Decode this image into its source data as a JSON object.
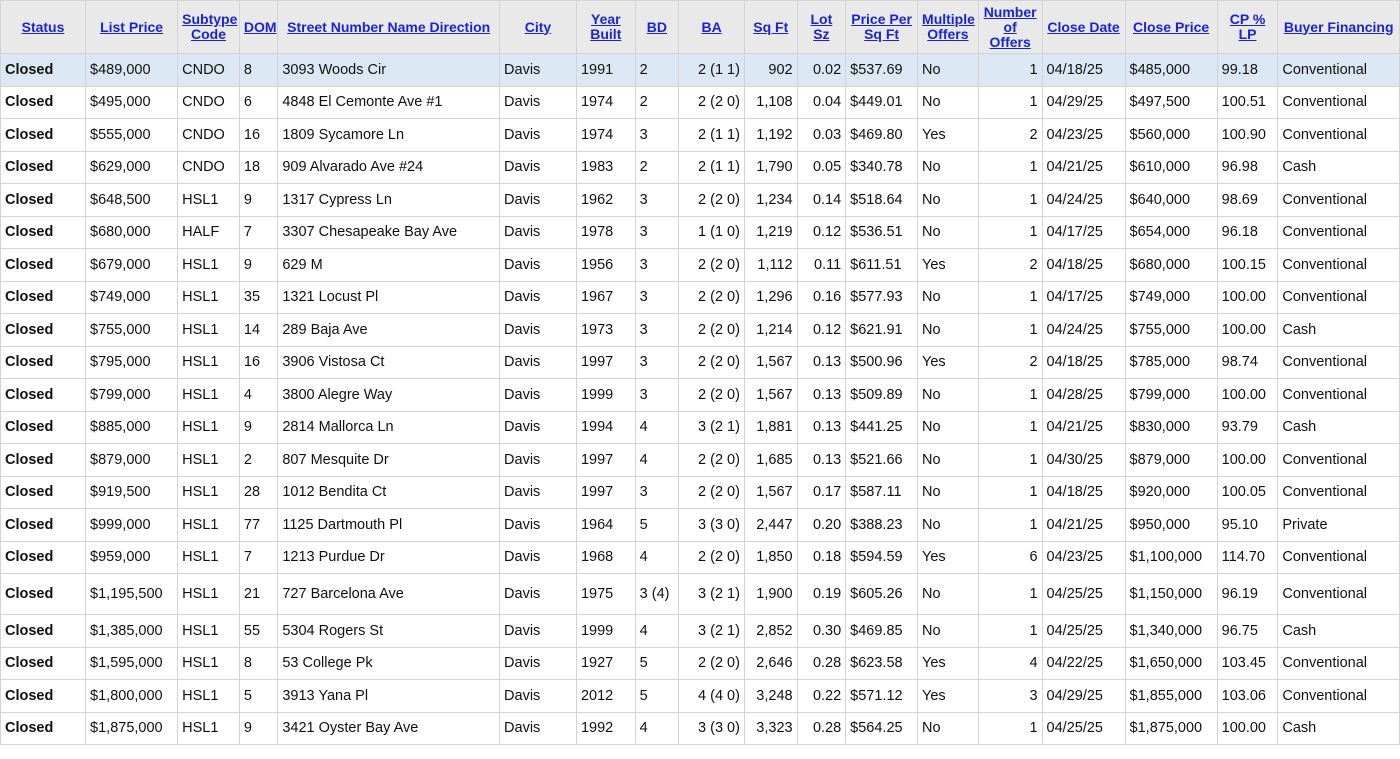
{
  "columns": [
    {
      "key": "status",
      "label": "Status",
      "align": "l",
      "width": 84
    },
    {
      "key": "list_price",
      "label": "List Price",
      "align": "l",
      "width": 91
    },
    {
      "key": "subtype",
      "label": "Subtype Code",
      "align": "l",
      "width": 61
    },
    {
      "key": "dom",
      "label": "DOM",
      "align": "l",
      "width": 38
    },
    {
      "key": "address",
      "label": "Street Number Name Direction",
      "align": "l",
      "width": 219
    },
    {
      "key": "city",
      "label": "City",
      "align": "l",
      "width": 76
    },
    {
      "key": "year_built",
      "label": "Year Built",
      "align": "l",
      "width": 58
    },
    {
      "key": "bd",
      "label": "BD",
      "align": "l",
      "width": 43
    },
    {
      "key": "ba",
      "label": "BA",
      "align": "r",
      "width": 65
    },
    {
      "key": "sqft",
      "label": "Sq Ft",
      "align": "r",
      "width": 52
    },
    {
      "key": "lot",
      "label": "Lot Sz",
      "align": "r",
      "width": 48
    },
    {
      "key": "ppsf",
      "label": "Price Per Sq Ft",
      "align": "l",
      "width": 71
    },
    {
      "key": "multi",
      "label": "Multiple Offers",
      "align": "l",
      "width": 60
    },
    {
      "key": "num_offers",
      "label": "Number of Offers",
      "align": "r",
      "width": 63
    },
    {
      "key": "close_date",
      "label": "Close Date",
      "align": "l",
      "width": 82
    },
    {
      "key": "close_price",
      "label": "Close Price",
      "align": "l",
      "width": 91
    },
    {
      "key": "cp_lp",
      "label": "CP % LP",
      "align": "l",
      "width": 60
    },
    {
      "key": "financing",
      "label": "Buyer Financing",
      "align": "l",
      "width": 120
    }
  ],
  "rows": [
    {
      "status": "Closed",
      "list_price": "$489,000",
      "subtype": "CNDO",
      "dom": "8",
      "address": "3093 Woods Cir",
      "city": "Davis",
      "year_built": "1991",
      "bd": "2",
      "ba": "2 (1 1)",
      "sqft": "902",
      "lot": "0.02",
      "ppsf": "$537.69",
      "multi": "No",
      "num_offers": "1",
      "close_date": "04/18/25",
      "close_price": "$485,000",
      "cp_lp": "99.18",
      "financing": "Conventional"
    },
    {
      "status": "Closed",
      "list_price": "$495,000",
      "subtype": "CNDO",
      "dom": "6",
      "address": "4848 El Cemonte Ave #1",
      "city": "Davis",
      "year_built": "1974",
      "bd": "2",
      "ba": "2 (2 0)",
      "sqft": "1,108",
      "lot": "0.04",
      "ppsf": "$449.01",
      "multi": "No",
      "num_offers": "1",
      "close_date": "04/29/25",
      "close_price": "$497,500",
      "cp_lp": "100.51",
      "financing": "Conventional"
    },
    {
      "status": "Closed",
      "list_price": "$555,000",
      "subtype": "CNDO",
      "dom": "16",
      "address": "1809 Sycamore Ln",
      "city": "Davis",
      "year_built": "1974",
      "bd": "3",
      "ba": "2 (1 1)",
      "sqft": "1,192",
      "lot": "0.03",
      "ppsf": "$469.80",
      "multi": "Yes",
      "num_offers": "2",
      "close_date": "04/23/25",
      "close_price": "$560,000",
      "cp_lp": "100.90",
      "financing": "Conventional"
    },
    {
      "status": "Closed",
      "list_price": "$629,000",
      "subtype": "CNDO",
      "dom": "18",
      "address": "909 Alvarado Ave #24",
      "city": "Davis",
      "year_built": "1983",
      "bd": "2",
      "ba": "2 (1 1)",
      "sqft": "1,790",
      "lot": "0.05",
      "ppsf": "$340.78",
      "multi": "No",
      "num_offers": "1",
      "close_date": "04/21/25",
      "close_price": "$610,000",
      "cp_lp": "96.98",
      "financing": "Cash"
    },
    {
      "status": "Closed",
      "list_price": "$648,500",
      "subtype": "HSL1",
      "dom": "9",
      "address": "1317 Cypress Ln",
      "city": "Davis",
      "year_built": "1962",
      "bd": "3",
      "ba": "2 (2 0)",
      "sqft": "1,234",
      "lot": "0.14",
      "ppsf": "$518.64",
      "multi": "No",
      "num_offers": "1",
      "close_date": "04/24/25",
      "close_price": "$640,000",
      "cp_lp": "98.69",
      "financing": "Conventional"
    },
    {
      "status": "Closed",
      "list_price": "$680,000",
      "subtype": "HALF",
      "dom": "7",
      "address": "3307 Chesapeake Bay Ave",
      "city": "Davis",
      "year_built": "1978",
      "bd": "3",
      "ba": "1 (1 0)",
      "sqft": "1,219",
      "lot": "0.12",
      "ppsf": "$536.51",
      "multi": "No",
      "num_offers": "1",
      "close_date": "04/17/25",
      "close_price": "$654,000",
      "cp_lp": "96.18",
      "financing": "Conventional"
    },
    {
      "status": "Closed",
      "list_price": "$679,000",
      "subtype": "HSL1",
      "dom": "9",
      "address": "629 M",
      "city": "Davis",
      "year_built": "1956",
      "bd": "3",
      "ba": "2 (2 0)",
      "sqft": "1,112",
      "lot": "0.11",
      "ppsf": "$611.51",
      "multi": "Yes",
      "num_offers": "2",
      "close_date": "04/18/25",
      "close_price": "$680,000",
      "cp_lp": "100.15",
      "financing": "Conventional"
    },
    {
      "status": "Closed",
      "list_price": "$749,000",
      "subtype": "HSL1",
      "dom": "35",
      "address": "1321 Locust Pl",
      "city": "Davis",
      "year_built": "1967",
      "bd": "3",
      "ba": "2 (2 0)",
      "sqft": "1,296",
      "lot": "0.16",
      "ppsf": "$577.93",
      "multi": "No",
      "num_offers": "1",
      "close_date": "04/17/25",
      "close_price": "$749,000",
      "cp_lp": "100.00",
      "financing": "Conventional"
    },
    {
      "status": "Closed",
      "list_price": "$755,000",
      "subtype": "HSL1",
      "dom": "14",
      "address": "289 Baja Ave",
      "city": "Davis",
      "year_built": "1973",
      "bd": "3",
      "ba": "2 (2 0)",
      "sqft": "1,214",
      "lot": "0.12",
      "ppsf": "$621.91",
      "multi": "No",
      "num_offers": "1",
      "close_date": "04/24/25",
      "close_price": "$755,000",
      "cp_lp": "100.00",
      "financing": "Cash"
    },
    {
      "status": "Closed",
      "list_price": "$795,000",
      "subtype": "HSL1",
      "dom": "16",
      "address": "3906 Vistosa Ct",
      "city": "Davis",
      "year_built": "1997",
      "bd": "3",
      "ba": "2 (2 0)",
      "sqft": "1,567",
      "lot": "0.13",
      "ppsf": "$500.96",
      "multi": "Yes",
      "num_offers": "2",
      "close_date": "04/18/25",
      "close_price": "$785,000",
      "cp_lp": "98.74",
      "financing": "Conventional"
    },
    {
      "status": "Closed",
      "list_price": "$799,000",
      "subtype": "HSL1",
      "dom": "4",
      "address": "3800 Alegre Way",
      "city": "Davis",
      "year_built": "1999",
      "bd": "3",
      "ba": "2 (2 0)",
      "sqft": "1,567",
      "lot": "0.13",
      "ppsf": "$509.89",
      "multi": "No",
      "num_offers": "1",
      "close_date": "04/28/25",
      "close_price": "$799,000",
      "cp_lp": "100.00",
      "financing": "Conventional"
    },
    {
      "status": "Closed",
      "list_price": "$885,000",
      "subtype": "HSL1",
      "dom": "9",
      "address": "2814 Mallorca Ln",
      "city": "Davis",
      "year_built": "1994",
      "bd": "4",
      "ba": "3 (2 1)",
      "sqft": "1,881",
      "lot": "0.13",
      "ppsf": "$441.25",
      "multi": "No",
      "num_offers": "1",
      "close_date": "04/21/25",
      "close_price": "$830,000",
      "cp_lp": "93.79",
      "financing": "Cash"
    },
    {
      "status": "Closed",
      "list_price": "$879,000",
      "subtype": "HSL1",
      "dom": "2",
      "address": "807 Mesquite Dr",
      "city": "Davis",
      "year_built": "1997",
      "bd": "4",
      "ba": "2 (2 0)",
      "sqft": "1,685",
      "lot": "0.13",
      "ppsf": "$521.66",
      "multi": "No",
      "num_offers": "1",
      "close_date": "04/30/25",
      "close_price": "$879,000",
      "cp_lp": "100.00",
      "financing": "Conventional"
    },
    {
      "status": "Closed",
      "list_price": "$919,500",
      "subtype": "HSL1",
      "dom": "28",
      "address": "1012 Bendita Ct",
      "city": "Davis",
      "year_built": "1997",
      "bd": "3",
      "ba": "2 (2 0)",
      "sqft": "1,567",
      "lot": "0.17",
      "ppsf": "$587.11",
      "multi": "No",
      "num_offers": "1",
      "close_date": "04/18/25",
      "close_price": "$920,000",
      "cp_lp": "100.05",
      "financing": "Conventional"
    },
    {
      "status": "Closed",
      "list_price": "$999,000",
      "subtype": "HSL1",
      "dom": "77",
      "address": "1125 Dartmouth Pl",
      "city": "Davis",
      "year_built": "1964",
      "bd": "5",
      "ba": "3 (3 0)",
      "sqft": "2,447",
      "lot": "0.20",
      "ppsf": "$388.23",
      "multi": "No",
      "num_offers": "1",
      "close_date": "04/21/25",
      "close_price": "$950,000",
      "cp_lp": "95.10",
      "financing": "Private"
    },
    {
      "status": "Closed",
      "list_price": "$959,000",
      "subtype": "HSL1",
      "dom": "7",
      "address": "1213 Purdue Dr",
      "city": "Davis",
      "year_built": "1968",
      "bd": "4",
      "ba": "2 (2 0)",
      "sqft": "1,850",
      "lot": "0.18",
      "ppsf": "$594.59",
      "multi": "Yes",
      "num_offers": "6",
      "close_date": "04/23/25",
      "close_price": "$1,100,000",
      "cp_lp": "114.70",
      "financing": "Conventional"
    },
    {
      "status": "Closed",
      "list_price": "$1,195,500",
      "subtype": "HSL1",
      "dom": "21",
      "address": "727 Barcelona Ave",
      "city": "Davis",
      "year_built": "1975",
      "bd": "3 (4)",
      "ba": "3 (2 1)",
      "sqft": "1,900",
      "lot": "0.19",
      "ppsf": "$605.26",
      "multi": "No",
      "num_offers": "1",
      "close_date": "04/25/25",
      "close_price": "$1,150,000",
      "cp_lp": "96.19",
      "financing": "Conventional"
    },
    {
      "status": "Closed",
      "list_price": "$1,385,000",
      "subtype": "HSL1",
      "dom": "55",
      "address": "5304 Rogers St",
      "city": "Davis",
      "year_built": "1999",
      "bd": "4",
      "ba": "3 (2 1)",
      "sqft": "2,852",
      "lot": "0.30",
      "ppsf": "$469.85",
      "multi": "No",
      "num_offers": "1",
      "close_date": "04/25/25",
      "close_price": "$1,340,000",
      "cp_lp": "96.75",
      "financing": "Cash"
    },
    {
      "status": "Closed",
      "list_price": "$1,595,000",
      "subtype": "HSL1",
      "dom": "8",
      "address": "53 College Pk",
      "city": "Davis",
      "year_built": "1927",
      "bd": "5",
      "ba": "2 (2 0)",
      "sqft": "2,646",
      "lot": "0.28",
      "ppsf": "$623.58",
      "multi": "Yes",
      "num_offers": "4",
      "close_date": "04/22/25",
      "close_price": "$1,650,000",
      "cp_lp": "103.45",
      "financing": "Conventional"
    },
    {
      "status": "Closed",
      "list_price": "$1,800,000",
      "subtype": "HSL1",
      "dom": "5",
      "address": "3913 Yana Pl",
      "city": "Davis",
      "year_built": "2012",
      "bd": "5",
      "ba": "4 (4 0)",
      "sqft": "3,248",
      "lot": "0.22",
      "ppsf": "$571.12",
      "multi": "Yes",
      "num_offers": "3",
      "close_date": "04/29/25",
      "close_price": "$1,855,000",
      "cp_lp": "103.06",
      "financing": "Conventional"
    },
    {
      "status": "Closed",
      "list_price": "$1,875,000",
      "subtype": "HSL1",
      "dom": "9",
      "address": "3421 Oyster Bay Ave",
      "city": "Davis",
      "year_built": "1992",
      "bd": "4",
      "ba": "3 (3 0)",
      "sqft": "3,323",
      "lot": "0.28",
      "ppsf": "$564.25",
      "multi": "No",
      "num_offers": "1",
      "close_date": "04/25/25",
      "close_price": "$1,875,000",
      "cp_lp": "100.00",
      "financing": "Cash"
    }
  ],
  "colors": {
    "header_bg": "#e9e9e9",
    "header_link": "#1a24d6",
    "status_closed": "#e8332a",
    "selected_row_bg": "#dbe8f4",
    "grid_line": "#d4d4d4"
  }
}
